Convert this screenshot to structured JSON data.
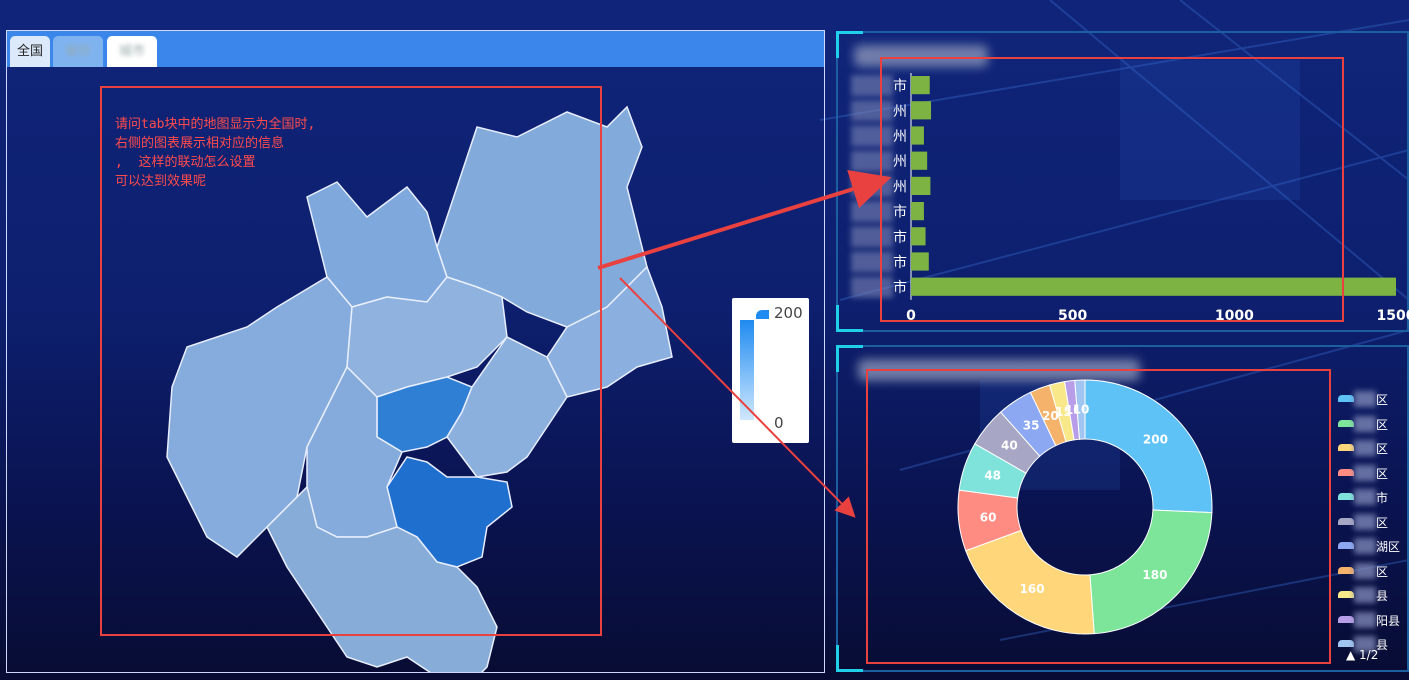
{
  "tabs": [
    {
      "label": "全国"
    },
    {
      "label": "省份"
    },
    {
      "label": "城市"
    }
  ],
  "question_text": "请问tab块中的地图显示为全国时,\n右侧的图表展示相对应的信息\n,  这样的联动怎么设置\n可以达到效果呢",
  "visual_map": {
    "max_label": "200",
    "min_label": "0"
  },
  "colors": {
    "accent": "#3a86ea",
    "bar": "#7cb342",
    "annotation": "#e94040",
    "panel_border": "#1b5fa0",
    "corner": "#1fd0e8"
  },
  "bar_chart": {
    "type": "bar",
    "orientation": "horizontal",
    "categories": [
      "市",
      "市",
      "市",
      "市",
      "州",
      "州",
      "州",
      "州",
      "市"
    ],
    "values": [
      1500,
      55,
      45,
      40,
      60,
      50,
      40,
      62,
      58
    ],
    "xlim": [
      0,
      1500
    ],
    "xticks": [
      "0",
      "500",
      "1000",
      "1500"
    ]
  },
  "chart_data": {
    "type": "pie",
    "values": [
      200,
      180,
      160,
      60,
      48,
      40,
      35,
      20,
      15,
      10,
      10
    ],
    "labels": [
      "200",
      "180",
      "160",
      "60",
      "48",
      "40",
      "35",
      "20",
      "15",
      "10",
      "10"
    ],
    "colors": [
      "#5ec2f6",
      "#7de59a",
      "#ffd77a",
      "#ff8c82",
      "#7fe3dc",
      "#a7a6c4",
      "#8da8f2",
      "#f5b26a",
      "#f8e889",
      "#b89ee8",
      "#9fc5f0"
    ]
  },
  "legend": [
    {
      "label": "区",
      "color": "#5ec2f6"
    },
    {
      "label": "区",
      "color": "#7de59a"
    },
    {
      "label": "区",
      "color": "#ffd77a"
    },
    {
      "label": "区",
      "color": "#ff8c82"
    },
    {
      "label": "市",
      "color": "#7fe3dc"
    },
    {
      "label": "区",
      "color": "#a7a6c4"
    },
    {
      "label": "湖区",
      "color": "#8da8f2"
    },
    {
      "label": "区",
      "color": "#f5b26a"
    },
    {
      "label": "县",
      "color": "#f8e889"
    },
    {
      "label": "阳县",
      "color": "#b89ee8"
    },
    {
      "label": "县",
      "color": "#9fc5f0"
    }
  ],
  "legend_pager": "▲ 1/2"
}
